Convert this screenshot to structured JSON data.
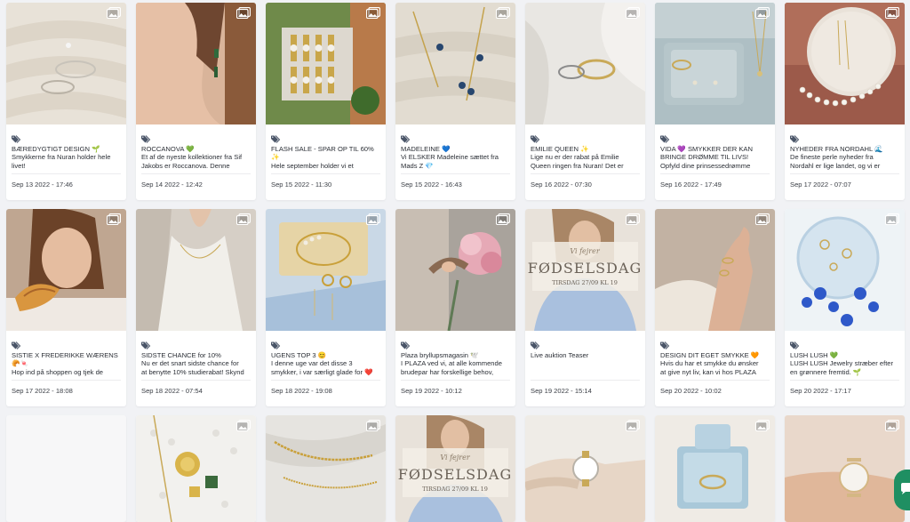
{
  "posts": [
    {
      "caption": [
        "BÆREDYGTIGT DESIGN 🌱",
        "Smykkerne fra Nuran holder hele",
        "livet!"
      ],
      "date": "Sep 13 2022 - 17:46"
    },
    {
      "caption": [
        "ROCCANOVA 💚",
        "Et af de nyeste kollektioner fra Sif",
        "Jakobs er Roccanova. Denne"
      ],
      "date": "Sep 14 2022 - 12:42"
    },
    {
      "caption": [
        "FLASH SALE - SPAR OP TIL 60%",
        "✨",
        "Hele september holder vi et"
      ],
      "date": "Sep 15 2022 - 11:30"
    },
    {
      "caption": [
        "MADELEINE 💙",
        "Vi ELSKER Madeleine sættet fra",
        "Mads Z 💎"
      ],
      "date": "Sep 15 2022 - 16:43"
    },
    {
      "caption": [
        "EMILIE QUEEN ✨",
        "Lige nu er der rabat på Emilie",
        "Queen ringen fra Nuran! Det er"
      ],
      "date": "Sep 16 2022 - 07:30"
    },
    {
      "caption": [
        "VIDA 💜 SMYKKER DER KAN",
        "BRINGE DRØMME TIL LIVS!",
        "Opfyld dine prinsessedrømme"
      ],
      "date": "Sep 16 2022 - 17:49"
    },
    {
      "caption": [
        "NYHEDER FRA NORDAHL 🌊",
        "De fineste perle nyheder fra",
        "Nordahl er lige landet, og vi er"
      ],
      "date": "Sep 17 2022 - 07:07"
    },
    {
      "caption": [
        "SISTIE X FREDERIKKE WÆRENS",
        "🥐🍬",
        "Hop ind på shoppen og tjek de"
      ],
      "date": "Sep 17 2022 - 18:08"
    },
    {
      "caption": [
        "SIDSTE CHANCE for 10%",
        "Nu er det snart sidste chance for",
        "at benytte 10% studierabat! Skynd"
      ],
      "date": "Sep 18 2022 - 07:54"
    },
    {
      "caption": [
        "UGENS TOP 3 😊",
        "I denne uge var det disse 3",
        "smykker, i var særligt glade for ❤️"
      ],
      "date": "Sep 18 2022 - 19:08"
    },
    {
      "caption": [
        "Plaza bryllupsmagasin 🕊️",
        "I PLAZA ved vi, at alle kommende",
        "brudepar har forskellige behov,"
      ],
      "date": "Sep 19 2022 - 10:12"
    },
    {
      "caption": [
        "Live auktion Teaser"
      ],
      "date": "Sep 19 2022 - 15:14"
    },
    {
      "caption": [
        "DESIGN DIT EGET SMYKKE 🧡",
        "Hvis du har et smykke du ønsker",
        "at give nyt liv, kan vi hos PLAZA"
      ],
      "date": "Sep 20 2022 - 10:02"
    },
    {
      "caption": [
        "LUSH LUSH 💚",
        "LUSH LUSH Jewelry stræber efter",
        "en grønnere fremtid. 🌱"
      ],
      "date": "Sep 20 2022 - 17:17"
    }
  ],
  "overlay_texts": {
    "script": "Vi fejrer",
    "headline": "FØDSELSDAG",
    "subline": "TIRSDAG 27/09 KL 19"
  },
  "icons": {
    "media": "image-gallery-icon",
    "tag": "tag-icon",
    "chat": "chat-icon"
  },
  "colors": {
    "background": "#f1f2f5",
    "card": "#ffffff",
    "text": "#2b2f36",
    "chat_button": "#1f8f62"
  }
}
